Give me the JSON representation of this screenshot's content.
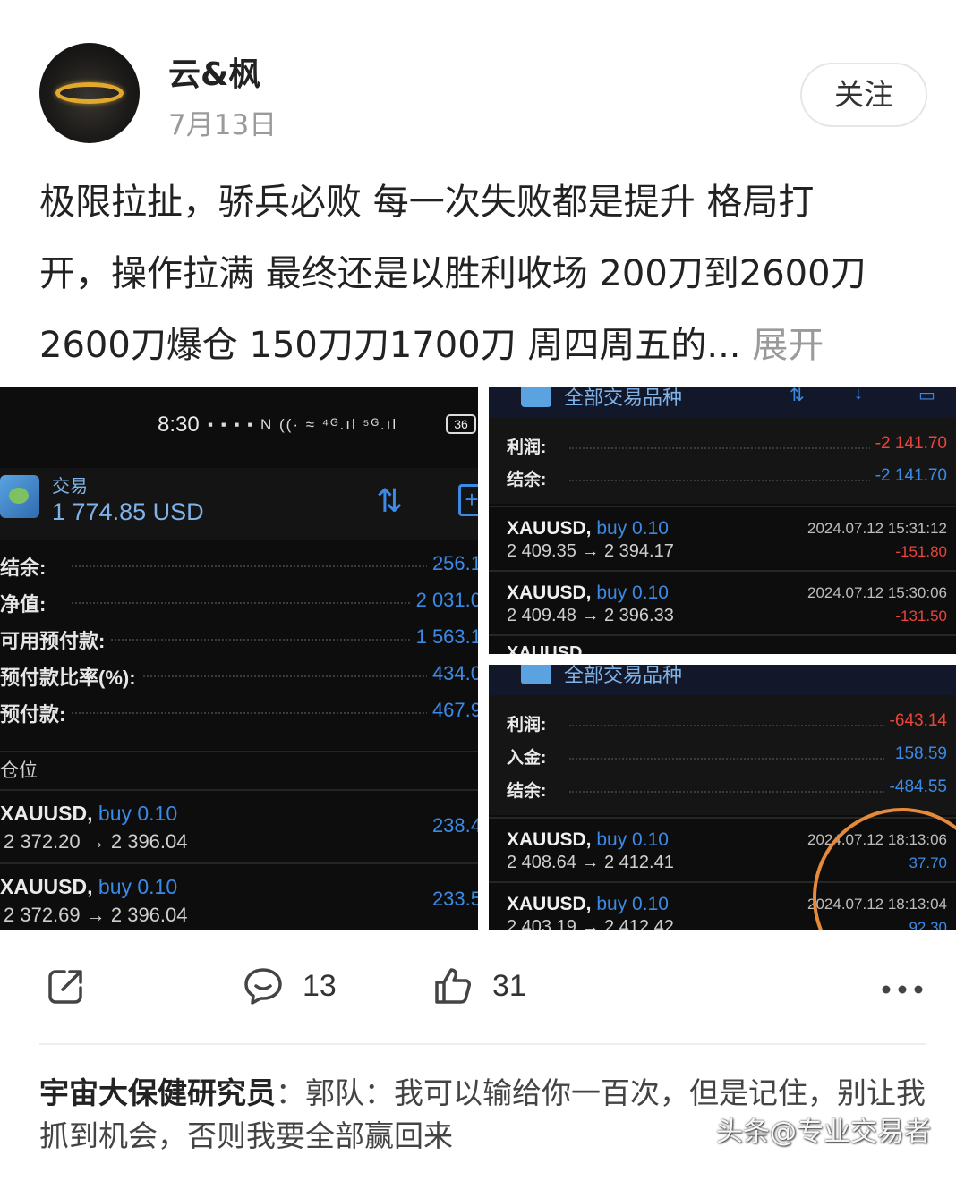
{
  "post": {
    "username": "云&枫",
    "date": "7月13日",
    "follow_label": "关注",
    "text_lines": [
      "极限拉扯，骄兵必败 每一次失败都是提升 格局打",
      "开，操作拉满 最终还是以胜利收场 200刀到2600刀",
      "2600刀爆仓 150刀刀1700刀 周四周五的..."
    ],
    "expand_label": "展开"
  },
  "screenshot_left": {
    "status_time": "8:30",
    "status_icons": "▪ ▪ ▪ ▪  N ((· ≈ ⁴ᴳ.ıl ⁵ᴳ.ıl",
    "battery": "36",
    "trade_title": "交易",
    "trade_amount": "1 774.85 USD",
    "account": [
      {
        "label": "结余:",
        "value": "256.1"
      },
      {
        "label": "净值:",
        "value": "2 031.0"
      },
      {
        "label": "可用预付款:",
        "value": "1 563.1"
      },
      {
        "label": "预付款比率(%):",
        "value": "434.0"
      },
      {
        "label": "预付款:",
        "value": "467.9"
      }
    ],
    "positions_label": "仓位",
    "positions": [
      {
        "symbol": "XAUUSD,",
        "side": "buy 0.10",
        "price": "2 372.20 → 2 396.04",
        "profit": "238.4"
      },
      {
        "symbol": "XAUUSD,",
        "side": "buy 0.10",
        "price": "2 372.69 → 2 396.04",
        "profit": "233.5"
      }
    ]
  },
  "screenshot_top_right": {
    "header": "全部交易品种",
    "summary": [
      {
        "label": "利润:",
        "value": "-2 141.70",
        "color": "#e8453c"
      },
      {
        "label": "结余:",
        "value": "-2 141.70",
        "color": "#3b8ae6"
      }
    ],
    "deals": [
      {
        "symbol": "XAUUSD,",
        "side": "buy 0.10",
        "price": "2 409.35 → 2 394.17",
        "time": "2024.07.12 15:31:12",
        "pl": "-151.80",
        "pl_color": "#e8453c"
      },
      {
        "symbol": "XAUUSD,",
        "side": "buy 0.10",
        "price": "2 409.48 → 2 396.33",
        "time": "2024.07.12 15:30:06",
        "pl": "-131.50",
        "pl_color": "#e8453c"
      }
    ],
    "partial_symbol": "XAUUSD"
  },
  "screenshot_bottom_right": {
    "header": "全部交易品种",
    "summary": [
      {
        "label": "利润:",
        "value": "-643.14",
        "color": "#e8453c"
      },
      {
        "label": "入金:",
        "value": "158.59",
        "color": "#3b8ae6"
      },
      {
        "label": "结余:",
        "value": "-484.55",
        "color": "#3b8ae6"
      }
    ],
    "deals": [
      {
        "symbol": "XAUUSD,",
        "side": "buy 0.10",
        "price": "2 408.64 → 2 412.41",
        "time": "2024.07.12 18:13:06",
        "pl": "37.70",
        "pl_color": "#3b8ae6"
      },
      {
        "symbol": "XAUUSD,",
        "side": "buy 0.10",
        "price": "2 403.19 → 2 412.42",
        "time": "2024.07.12 18:13:04",
        "pl": "92.30",
        "pl_color": "#3b8ae6"
      }
    ]
  },
  "actions": {
    "share_icon": "share-icon",
    "comment_icon": "comment-icon",
    "comment_count": "13",
    "like_icon": "thumbs-up-icon",
    "like_count": "31",
    "more_icon": "more-icon"
  },
  "comment": {
    "author": "宇宙大保健研究员",
    "separator": "：",
    "text": "郭队：我可以输给你一百次，但是记住，别让我抓到机会，否则我要全部赢回来"
  },
  "watermark": "头条@专业交易者",
  "colors": {
    "accent_blue": "#3b8ae6",
    "loss_red": "#e8453c",
    "annotation_orange": "#e68a3a"
  }
}
